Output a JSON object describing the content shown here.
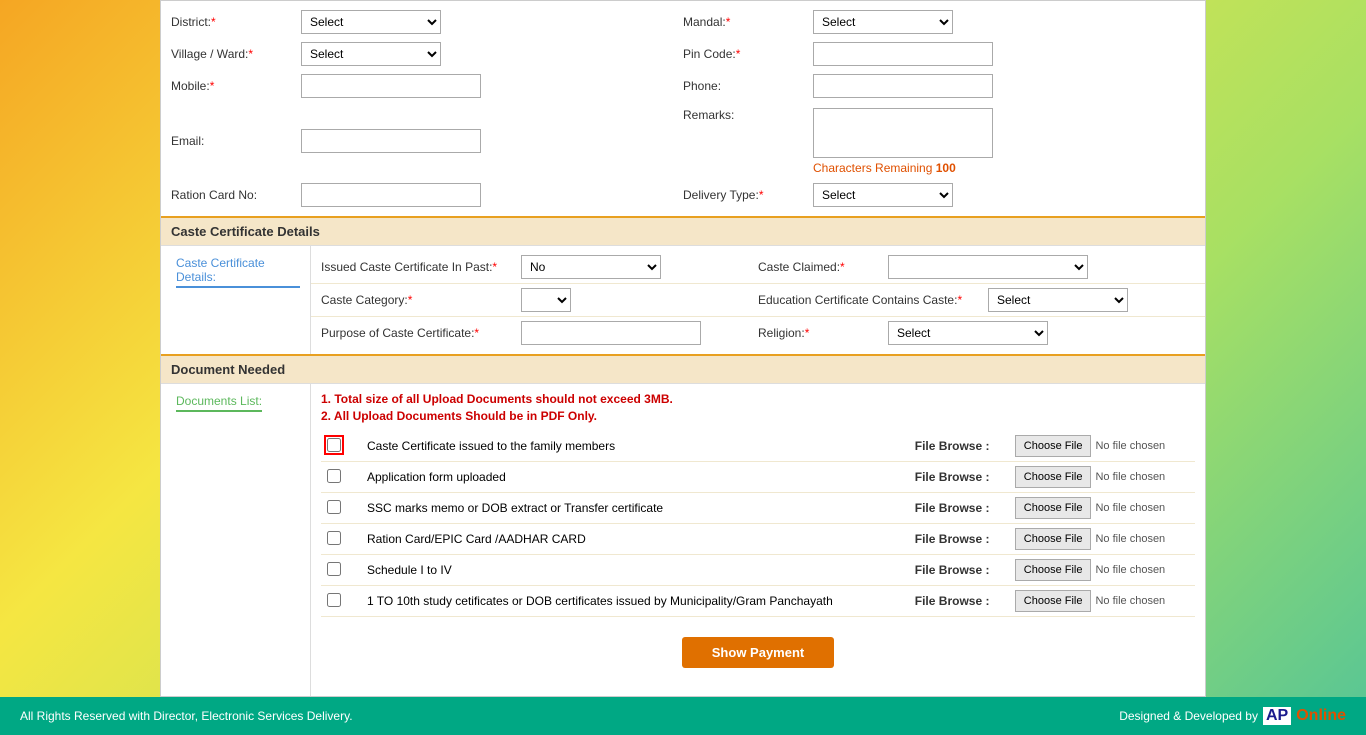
{
  "form": {
    "district_label": "District:",
    "mandal_label": "Mandal:",
    "village_label": "Village / Ward:",
    "pincode_label": "Pin Code:",
    "mobile_label": "Mobile:",
    "phone_label": "Phone:",
    "email_label": "Email:",
    "remarks_label": "Remarks:",
    "ration_label": "Ration Card No:",
    "delivery_label": "Delivery Type:",
    "select_placeholder": "Select",
    "chars_remaining_label": "Characters Remaining",
    "chars_remaining_value": "100"
  },
  "caste_section": {
    "title": "Caste Certificate Details",
    "sidebar_label": "Caste Certificate Details:",
    "issued_label": "Issued Caste Certificate In Past:",
    "issued_value": "No",
    "caste_claimed_label": "Caste Claimed:",
    "caste_category_label": "Caste Category:",
    "edu_cert_label": "Education Certificate Contains Caste:",
    "purpose_label": "Purpose of Caste Certificate:",
    "religion_label": "Religion:",
    "select": "Select"
  },
  "document_section": {
    "title": "Document Needed",
    "sidebar_label": "Documents List:",
    "note1": "1. Total size of all Upload Documents should not exceed 3MB.",
    "note2": "2. All Upload Documents Should be in PDF Only.",
    "file_browse_label": "File Browse :",
    "no_file": "No file chosen",
    "choose_file": "Choose File",
    "documents": [
      {
        "id": "doc1",
        "label": "Caste Certificate issued to the family members",
        "highlighted": true
      },
      {
        "id": "doc2",
        "label": "Application form uploaded",
        "highlighted": false
      },
      {
        "id": "doc3",
        "label": "SSC marks memo or DOB extract or Transfer certificate",
        "highlighted": false
      },
      {
        "id": "doc4",
        "label": "Ration Card/EPIC Card /AADHAR CARD",
        "highlighted": false
      },
      {
        "id": "doc5",
        "label": "Schedule I to IV",
        "highlighted": false
      },
      {
        "id": "doc6",
        "label": "1 TO 10th study cetificates or DOB certificates issued by Municipality/Gram Panchayath",
        "highlighted": false
      }
    ]
  },
  "show_payment_btn": "Show Payment",
  "footer": {
    "left": "All Rights Reserved with Director, Electronic Services Delivery.",
    "right_prefix": "Designed & Developed by",
    "brand_ap": "AP",
    "brand_online": "Online"
  }
}
